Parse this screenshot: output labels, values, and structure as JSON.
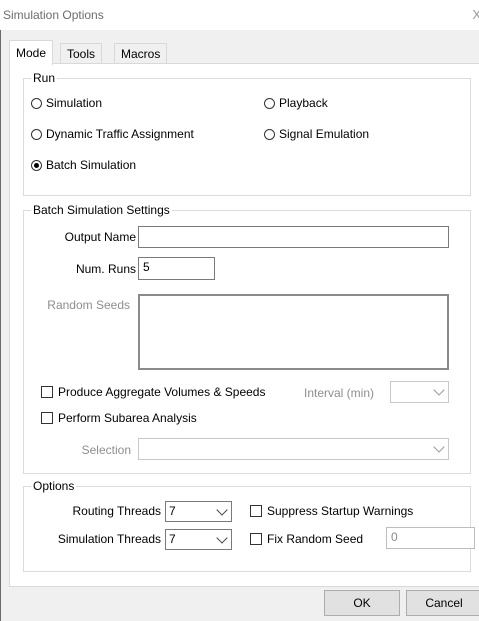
{
  "window": {
    "title": "Simulation Options",
    "close_glyph": "X"
  },
  "tabs": [
    {
      "label": "Mode",
      "active": true
    },
    {
      "label": "Tools",
      "active": false
    },
    {
      "label": "Macros",
      "active": false
    }
  ],
  "run": {
    "group_label": "Run",
    "options": [
      {
        "label": "Simulation",
        "checked": false
      },
      {
        "label": "Playback",
        "checked": false
      },
      {
        "label": "Dynamic Traffic Assignment",
        "checked": false
      },
      {
        "label": "Signal Emulation",
        "checked": false
      },
      {
        "label": "Batch Simulation",
        "checked": true
      }
    ]
  },
  "batch": {
    "group_label": "Batch Simulation Settings",
    "output_name_label": "Output Name",
    "output_name_value": "",
    "num_runs_label": "Num. Runs",
    "num_runs_value": "5",
    "random_seeds_label": "Random Seeds",
    "random_seeds_value": "",
    "aggregate_label": "Produce Aggregate Volumes & Speeds",
    "interval_label": "Interval (min)",
    "interval_value": "",
    "subarea_label": "Perform Subarea Analysis",
    "selection_label": "Selection",
    "selection_value": ""
  },
  "options": {
    "group_label": "Options",
    "routing_threads_label": "Routing Threads",
    "routing_threads_value": "7",
    "simulation_threads_label": "Simulation Threads",
    "simulation_threads_value": "7",
    "suppress_label": "Suppress Startup Warnings",
    "fix_seed_label": "Fix Random Seed",
    "fix_seed_value": "0"
  },
  "buttons": {
    "ok": "OK",
    "cancel": "Cancel"
  }
}
